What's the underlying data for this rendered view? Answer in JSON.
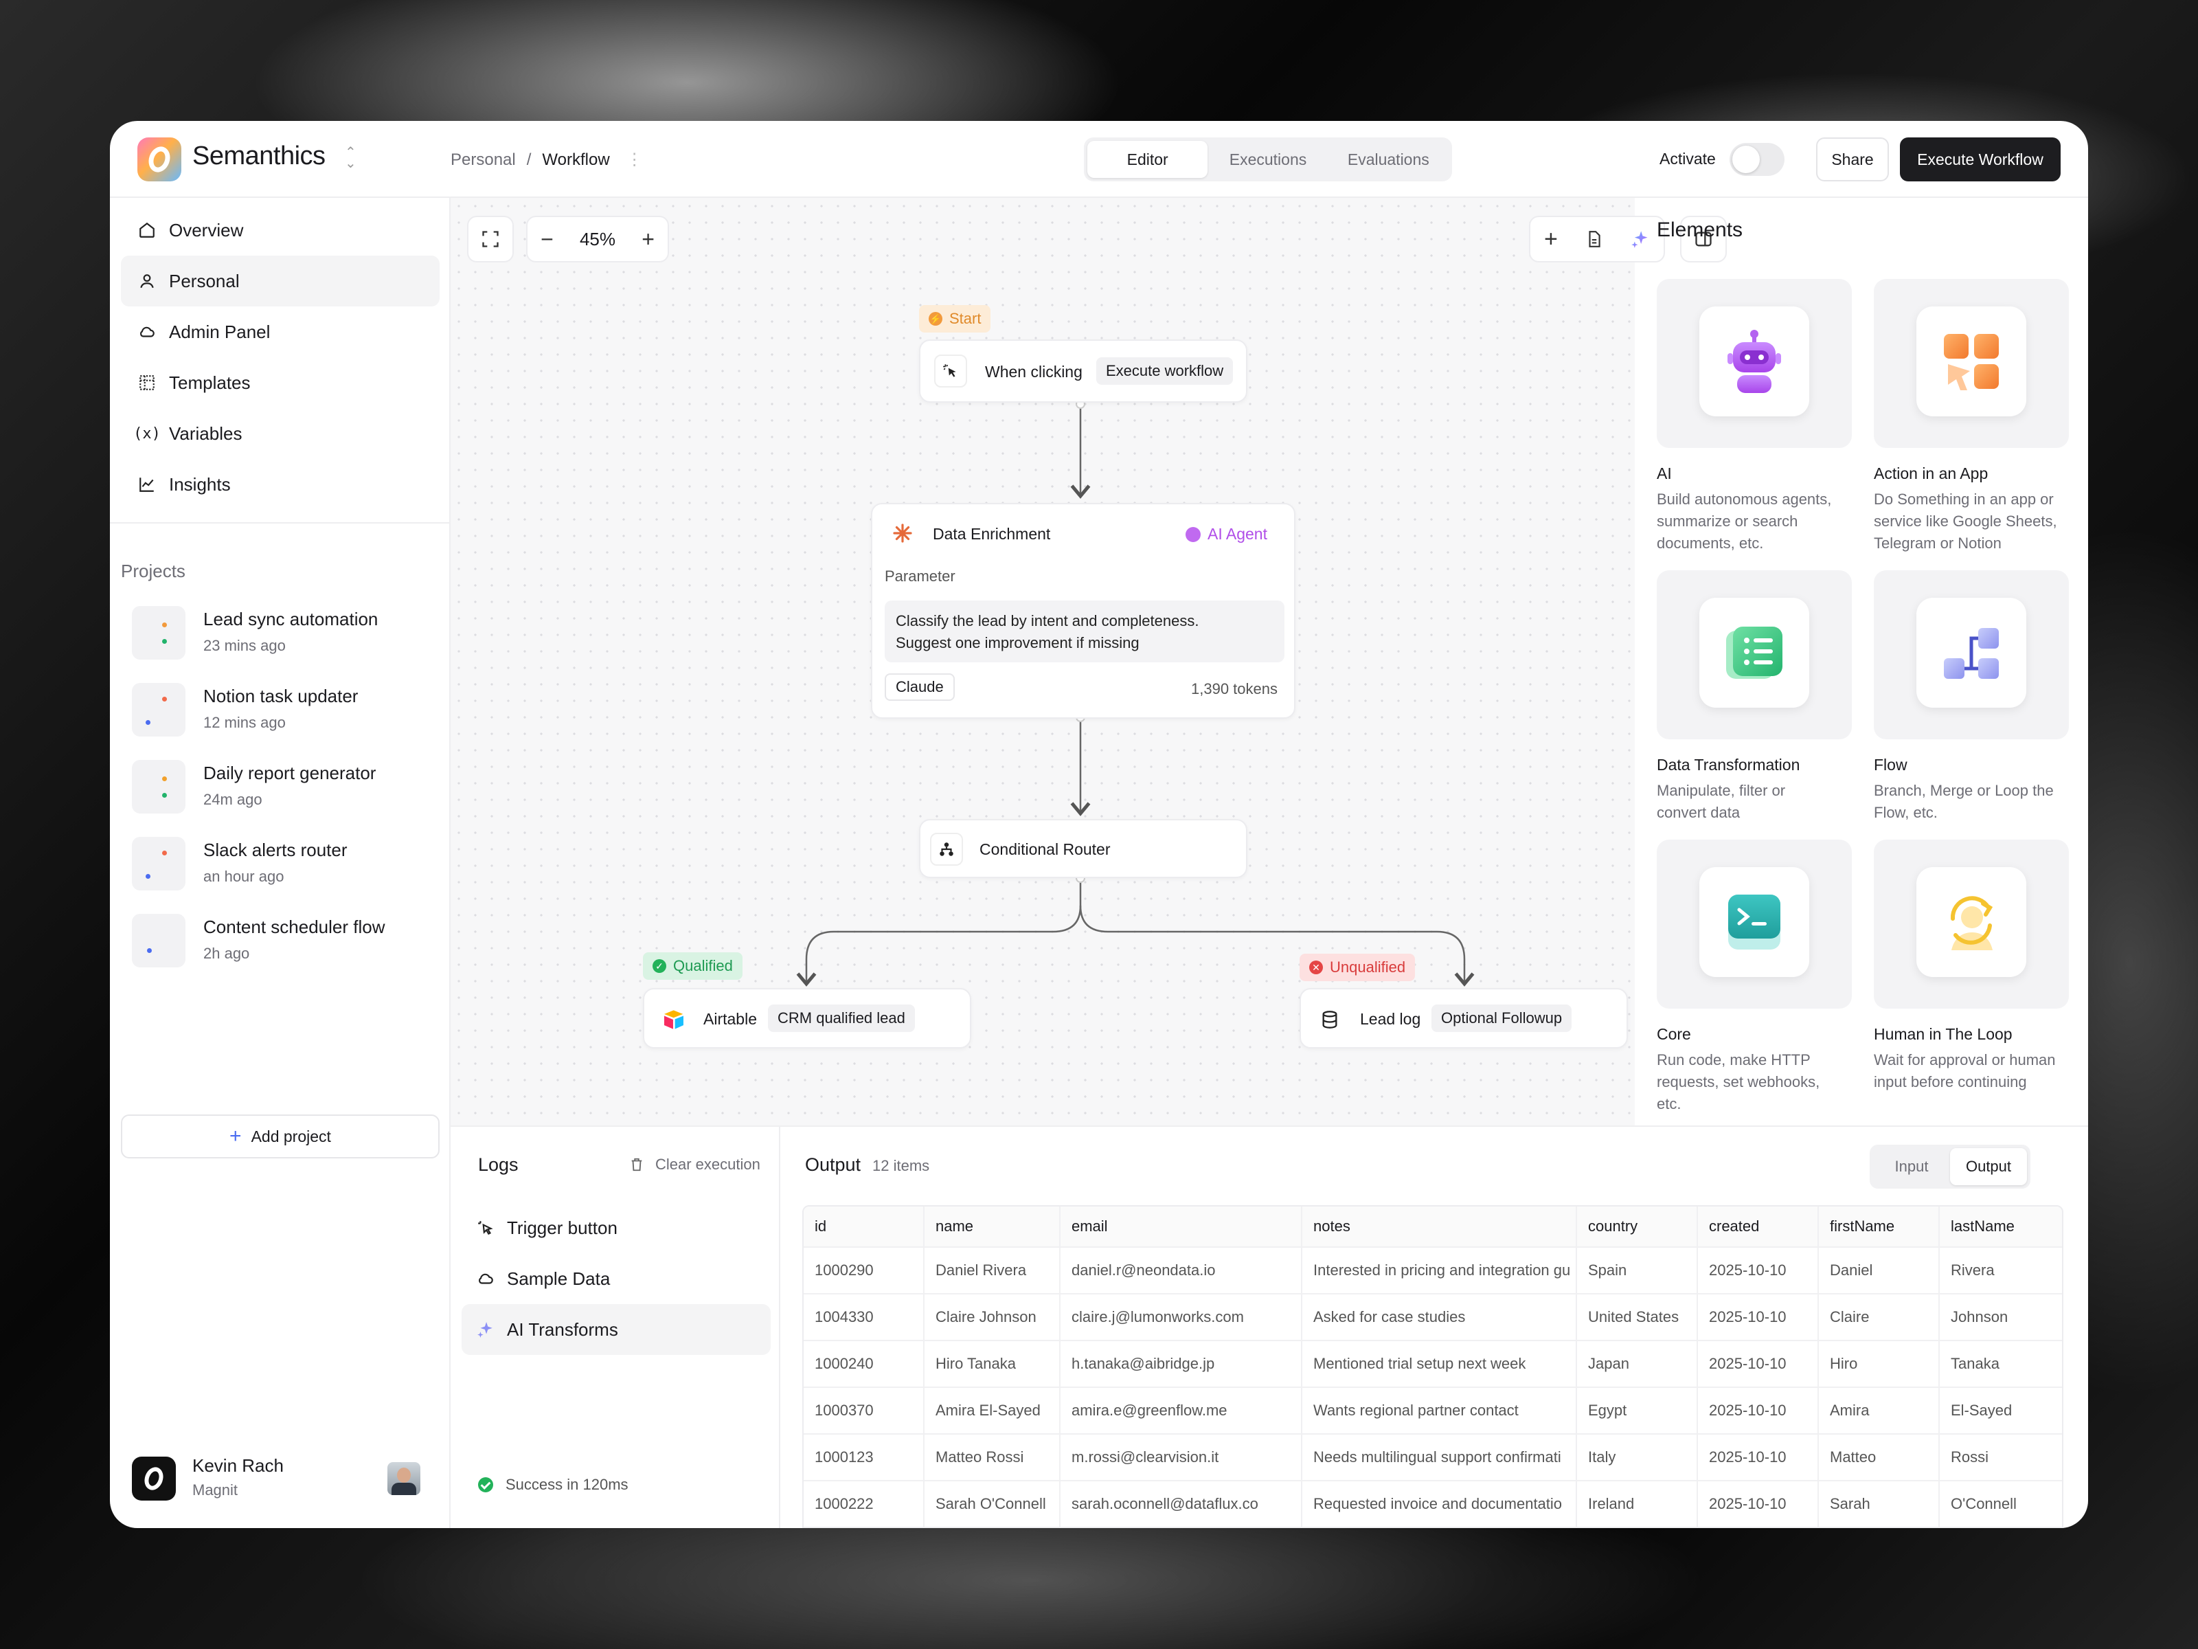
{
  "app": {
    "name": "Semanthics"
  },
  "breadcrumb": {
    "parent": "Personal",
    "current": "Workflow"
  },
  "tabs": [
    {
      "label": "Editor",
      "active": true
    },
    {
      "label": "Executions"
    },
    {
      "label": "Evaluations"
    }
  ],
  "topbar": {
    "activate_label": "Activate",
    "activate_on": false,
    "share_label": "Share",
    "execute_label": "Execute Workflow"
  },
  "sidebar": {
    "nav": [
      {
        "label": "Overview",
        "icon": "home-icon"
      },
      {
        "label": "Personal",
        "icon": "user-icon",
        "selected": true
      },
      {
        "label": "Admin Panel",
        "icon": "cloud-icon"
      },
      {
        "label": "Templates",
        "icon": "grid-icon"
      },
      {
        "label": "Variables",
        "icon": "variable-icon"
      },
      {
        "label": "Insights",
        "icon": "chart-icon"
      }
    ],
    "projects_heading": "Projects",
    "projects": [
      {
        "name": "Lead sync automation",
        "time": "23 mins ago"
      },
      {
        "name": "Notion task updater",
        "time": "12 mins ago"
      },
      {
        "name": "Daily report generator",
        "time": "24m ago"
      },
      {
        "name": "Slack alerts router",
        "time": "an hour ago"
      },
      {
        "name": "Content scheduler flow",
        "time": "2h ago"
      }
    ],
    "add_project": "Add project",
    "user": {
      "name": "Kevin Rach",
      "org": "Magnit"
    }
  },
  "canvas": {
    "zoom": "45%",
    "start": {
      "badge": "Start",
      "label": "When clicking",
      "chip": "Execute workflow"
    },
    "enrichment": {
      "title": "Data Enrichment",
      "badge": "AI Agent",
      "param_label": "Parameter",
      "param_line1": "Classify the lead by intent and completeness.",
      "param_line2": "Suggest one improvement if missing",
      "model": "Claude",
      "tokens": "1,390 tokens"
    },
    "router": {
      "label": "Conditional Router"
    },
    "qualified": {
      "badge": "Qualified",
      "label": "Airtable",
      "chip": "CRM qualified lead"
    },
    "unqualified": {
      "badge": "Unqualified",
      "label": "Lead log",
      "chip": "Optional Followup"
    }
  },
  "elements": {
    "title": "Elements",
    "items": [
      {
        "title": "AI",
        "desc": [
          "Build autonomous agents,",
          "summarize or search",
          "documents, etc."
        ],
        "icon": "robot-icon"
      },
      {
        "title": "Action in an App",
        "desc": [
          "Do Something in an app or",
          "service like Google Sheets,",
          "Telegram or Notion"
        ],
        "icon": "app-action-icon"
      },
      {
        "title": "Data Transformation",
        "desc": [
          "Manipulate, filter or",
          "convert data"
        ],
        "icon": "list-icon"
      },
      {
        "title": "Flow",
        "desc": [
          "Branch, Merge or Loop the",
          "Flow, etc."
        ],
        "icon": "flow-icon"
      },
      {
        "title": "Core",
        "desc": [
          "Run code, make HTTP",
          "requests, set webhooks,",
          "etc."
        ],
        "icon": "terminal-icon"
      },
      {
        "title": "Human in The Loop",
        "desc": [
          "Wait for approval or human",
          "input before continuing"
        ],
        "icon": "human-loop-icon"
      }
    ]
  },
  "logs": {
    "title": "Logs",
    "clear": "Clear execution",
    "items": [
      {
        "label": "Trigger button",
        "icon": "cursor-click-icon"
      },
      {
        "label": "Sample Data",
        "icon": "cloud-icon"
      },
      {
        "label": "AI Transforms",
        "icon": "sparkle-icon",
        "selected": true
      }
    ],
    "status": "Success in 120ms"
  },
  "output": {
    "title": "Output",
    "count": "12 items",
    "toggle": {
      "input": "Input",
      "output": "Output",
      "active": "Output"
    },
    "columns": [
      "id",
      "name",
      "email",
      "notes",
      "country",
      "created",
      "firstName",
      "lastName"
    ],
    "rows": [
      [
        "1000290",
        "Daniel Rivera",
        "daniel.r@neondata.io",
        "Interested in pricing and integration gu",
        "Spain",
        "2025-10-10",
        "Daniel",
        "Rivera"
      ],
      [
        "1004330",
        "Claire Johnson",
        "claire.j@lumonworks.com",
        "Asked for case studies",
        "United States",
        "2025-10-10",
        "Claire",
        "Johnson"
      ],
      [
        "1000240",
        "Hiro Tanaka",
        "h.tanaka@aibridge.jp",
        "Mentioned trial setup next week",
        "Japan",
        "2025-10-10",
        "Hiro",
        "Tanaka"
      ],
      [
        "1000370",
        "Amira El-Sayed",
        "amira.e@greenflow.me",
        "Wants regional partner contact",
        "Egypt",
        "2025-10-10",
        "Amira",
        "El-Sayed"
      ],
      [
        "1000123",
        "Matteo Rossi",
        "m.rossi@clearvision.it",
        "Needs multilingual support confirmati",
        "Italy",
        "2025-10-10",
        "Matteo",
        "Rossi"
      ],
      [
        "1000222",
        "Sarah O'Connell",
        "sarah.oconnell@dataflux.co",
        "Requested invoice and documentatio",
        "Ireland",
        "2025-10-10",
        "Sarah",
        "O'Connell"
      ]
    ]
  }
}
